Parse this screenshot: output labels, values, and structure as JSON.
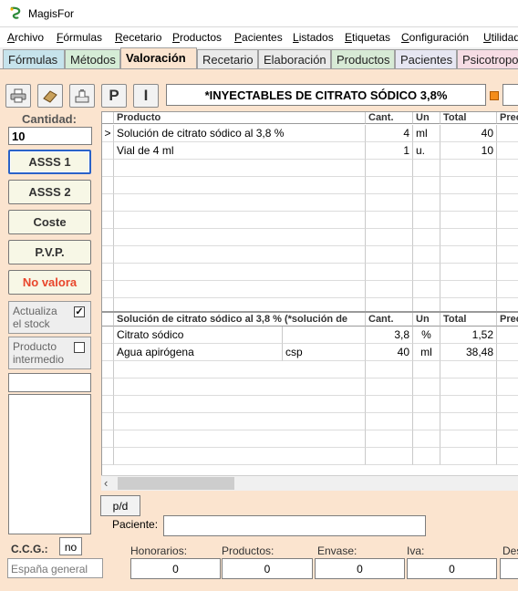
{
  "window": {
    "title": "MagisFor"
  },
  "menu": [
    "Archivo",
    "Fórmulas",
    "Recetario",
    "Productos",
    "Pacientes",
    "Listados",
    "Etiquetas",
    "Configuración",
    "Utilidad"
  ],
  "menu_mnemonics": [
    "A",
    "F",
    "R",
    "P",
    "P",
    "L",
    "E",
    "C",
    "U"
  ],
  "tabs": [
    "Fórmulas",
    "Métodos",
    "Valoración",
    "Recetario",
    "Elaboración",
    "Productos",
    "Pacientes",
    "Psicotropos"
  ],
  "active_tab": "Valoración",
  "toolbar": {
    "p_label": "P",
    "i_label": "I"
  },
  "formula_title": "*INYECTABLES DE CITRATO SÓDICO 3,8%",
  "sidebar": {
    "cantidad_label": "Cantidad:",
    "cantidad_value": "10",
    "buttons": [
      "ASSS 1",
      "ASSS 2",
      "Coste",
      "P.V.P.",
      "No valora"
    ],
    "actualiza_label_1": "Actualiza",
    "actualiza_label_2": "el stock",
    "actualiza_checked": "✓",
    "intermedio_label_1": "Producto",
    "intermedio_label_2": "intermedio"
  },
  "top_table": {
    "headers": [
      "Producto",
      "Cant.",
      "Un",
      "Total",
      "Prec"
    ],
    "rows": [
      {
        "marker": ">",
        "producto": "Solución de citrato sódico al 3,8 %",
        "cant": "4",
        "un": "ml",
        "total": "40"
      },
      {
        "marker": "",
        "producto": "Vial de 4 ml",
        "cant": "1",
        "un": "u.",
        "total": "10"
      }
    ]
  },
  "bottom_table": {
    "headers": [
      "Solución de citrato sódico al 3,8 % (*solución de",
      "Cant.",
      "Un",
      "Total",
      "Prec"
    ],
    "rows": [
      {
        "producto": "Citrato sódico",
        "extra": "",
        "cant": "3,8",
        "un": "%",
        "total": "1,52"
      },
      {
        "producto": "Agua apirógena",
        "extra": "csp",
        "cant": "40",
        "un": "ml",
        "total": "38,48"
      }
    ]
  },
  "footer": {
    "pd_label": "p/d",
    "paciente_label": "Paciente:",
    "ccg_label": "C.C.G.:",
    "ccg_value": "no",
    "region": "España general",
    "totals": [
      {
        "label": "Honorarios:",
        "value": "0"
      },
      {
        "label": "Productos:",
        "value": "0"
      },
      {
        "label": "Envase:",
        "value": "0"
      },
      {
        "label": "Iva:",
        "value": "0"
      },
      {
        "label": "Des",
        "value": ""
      }
    ]
  },
  "colors": {
    "background": "#fbe4cf",
    "focus": "#2a62c8",
    "warning_text": "#e8462c",
    "flag": "#f48c1a"
  }
}
